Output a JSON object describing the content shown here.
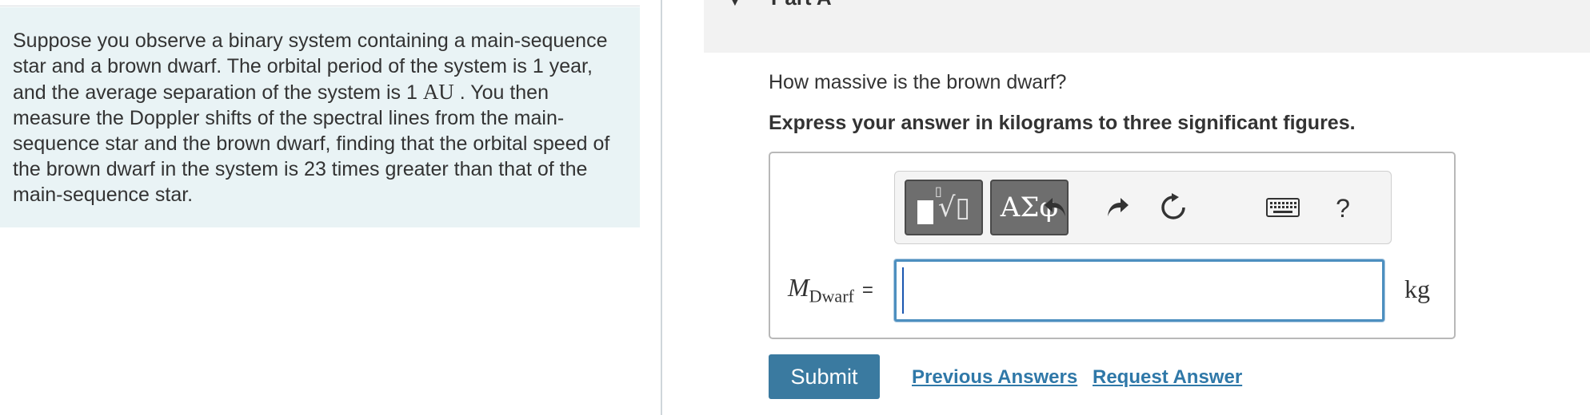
{
  "problem": {
    "text_before": "Suppose you observe a binary system containing a main-sequence star and a brown dwarf. The orbital period of the system is 1 year, and the average separation of the system is 1 ",
    "unit_au": "AU",
    "text_after": " . You then measure the Doppler shifts of the spectral lines from the main-sequence star and the brown dwarf, finding that the orbital speed of the brown dwarf in the system is 23 times greater than that of the main-sequence star."
  },
  "part": {
    "title": "Part A"
  },
  "question": {
    "prompt": "How massive is the brown dwarf?",
    "instruction": "Express your answer in kilograms to three significant figures."
  },
  "toolbar": {
    "template_icon": "templates-icon",
    "greek_label": "ΑΣφ",
    "undo_icon": "undo-icon",
    "redo_icon": "redo-icon",
    "reset_icon": "reset-icon",
    "keyboard_icon": "keyboard-icon",
    "help_label": "?"
  },
  "answer": {
    "variable": "M",
    "subscript": "Dwarf",
    "equals": "=",
    "value": "",
    "unit": "kg"
  },
  "actions": {
    "submit_label": "Submit",
    "previous_answers_label": "Previous Answers",
    "request_answer_label": "Request Answer"
  },
  "colors": {
    "panel_bg": "#e9f3f5",
    "submit_bg": "#3a7aa0",
    "link": "#2f78a8",
    "input_border": "#4d8fbf"
  }
}
